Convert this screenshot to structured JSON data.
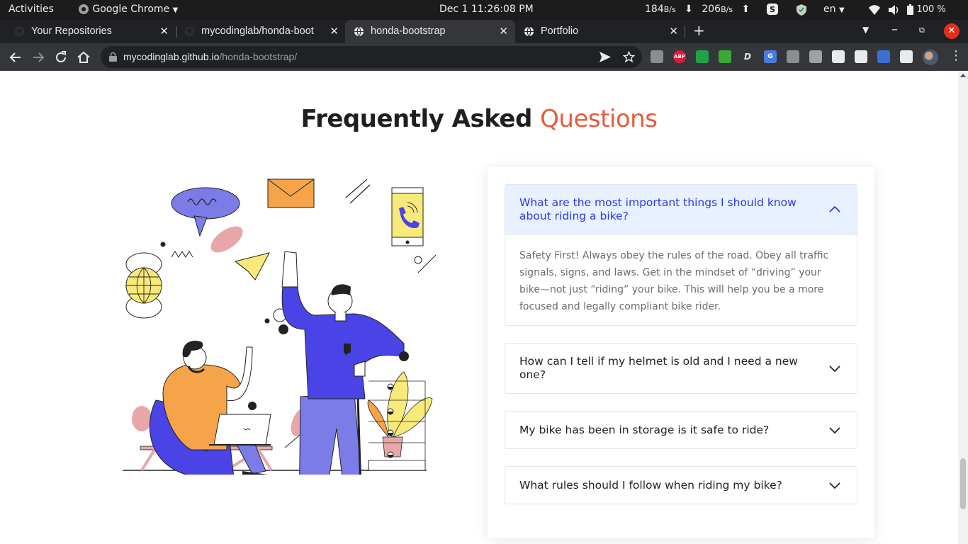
{
  "system_bar": {
    "activities": "Activities",
    "app_menu": "Google Chrome",
    "clock": "Dec 1  11:26:08 PM",
    "net_down_value": "184",
    "net_down_unit": "B/s",
    "net_up_value": "206",
    "net_up_unit": "B/s",
    "language": "en",
    "battery": "100 %"
  },
  "browser": {
    "tabs": [
      {
        "title": "Your Repositories",
        "active": false
      },
      {
        "title": "mycodinglab/honda-boot",
        "active": false
      },
      {
        "title": "honda-bootstrap",
        "active": true
      },
      {
        "title": "Portfolio",
        "active": false
      }
    ],
    "url_host": "mycodinglab.github.io",
    "url_path": "/honda-bootstrap/",
    "extensions": [
      {
        "name": "gmail-icon",
        "label": "",
        "color": "#8a8d91"
      },
      {
        "name": "adblock-plus-icon",
        "label": "ABP",
        "color": "#e3173e"
      },
      {
        "name": "shield-check-icon",
        "label": "",
        "color": "#1ea446"
      },
      {
        "name": "download-arrow-icon",
        "label": "",
        "color": "#3aa935"
      },
      {
        "name": "script-d-icon",
        "label": "D",
        "color": "#35363a"
      },
      {
        "name": "google-translate-icon",
        "label": "G",
        "color": "#4a7bd8"
      },
      {
        "name": "grid-extension-icon",
        "label": "",
        "color": "#8a8d91"
      },
      {
        "name": "card-extension-icon",
        "label": "",
        "color": "#9ea1a5"
      },
      {
        "name": "eye-extension-icon",
        "label": "",
        "color": "#e8eaed"
      },
      {
        "name": "react-devtools-icon",
        "label": "",
        "color": "#e8eaed"
      },
      {
        "name": "flag-extension-icon",
        "label": "",
        "color": "#3b6fd1"
      },
      {
        "name": "puzzle-icon",
        "label": "",
        "color": "#e8eaed"
      }
    ]
  },
  "page": {
    "heading_part1": "Frequently Asked",
    "heading_part2": "Questions",
    "accent_color": "#e85a3c",
    "faqs": [
      {
        "question": "What are the most important things I should know about riding a bike?",
        "answer": "Safety First! Always obey the rules of the road. Obey all traffic signals, signs, and laws. Get in the mindset of “driving” your bike—not just “riding” your bike. This will help you be a more focused and legally compliant bike rider.",
        "expanded": true
      },
      {
        "question": "How can I tell if my helmet is old and I need a new one?",
        "expanded": false
      },
      {
        "question": "My bike has been in storage is it safe to ride?",
        "expanded": false
      },
      {
        "question": "What rules should I follow when riding my bike?",
        "expanded": false
      }
    ]
  }
}
